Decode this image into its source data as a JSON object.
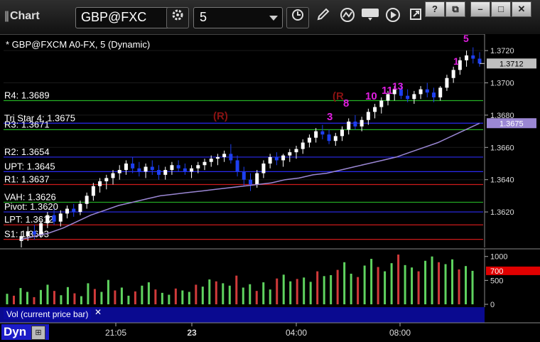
{
  "window": {
    "title": "Chart",
    "symbol": "GBP@FXC",
    "timeframe": "5"
  },
  "colors": {
    "bg": "#000000",
    "level_green": "#25b125",
    "level_red": "#cc1a1a",
    "level_blue": "#2a2af0",
    "up_candle": "#ffffff",
    "down_candle": "#1e3ff0",
    "ma": "#9b87d4",
    "vol_bar_green": "#5fd35f",
    "vol_bar_red": "#d13a3a",
    "annot_magenta": "#e01ee0",
    "annot_dark_red": "#8a1212",
    "annot_green": "#2fbf2f"
  },
  "header_label": "* GBP@FXCM A0-FX, 5 (Dynamic)",
  "levels": [
    {
      "label": "R4: 1.3689",
      "price": 1.3689,
      "color": "green"
    },
    {
      "label": "Tri Star 4: 1.3675",
      "price": 1.3675,
      "color": "blue"
    },
    {
      "label": "R3: 1.3671",
      "price": 1.3671,
      "color": "green"
    },
    {
      "label": "R2: 1.3654",
      "price": 1.3654,
      "color": "blue"
    },
    {
      "label": "UPT: 1.3645",
      "price": 1.3645,
      "color": "blue"
    },
    {
      "label": "R1: 1.3637",
      "price": 1.3637,
      "color": "red"
    },
    {
      "label": "VAH: 1.3626",
      "price": 1.3626,
      "color": "green"
    },
    {
      "label": "Pivot: 1.3620",
      "price": 1.362,
      "color": "blue"
    },
    {
      "label": "LPT: 1.3612",
      "price": 1.3612,
      "color": "red"
    },
    {
      "label": "S1: 1.3603",
      "price": 1.3603,
      "color": "red"
    }
  ],
  "annotations": [
    "(R)",
    "(R",
    "3",
    "8",
    "10",
    "11",
    "13",
    "5",
    "1"
  ],
  "chart_data": {
    "type": "candlestick",
    "price_axis": {
      "ticks": [
        1.372,
        1.37,
        1.368,
        1.366,
        1.364,
        1.362
      ],
      "tick_labels": [
        "1.3720",
        "1.3700",
        "1.3680",
        "1.3660",
        "1.3640",
        "1.3620"
      ],
      "current_price": "1.3712",
      "ma_value": "1.3675"
    },
    "time_axis": {
      "tick_labels": [
        "21:05",
        "23",
        "04:00",
        "08:00"
      ]
    },
    "ohlc": [
      [
        1.3602,
        1.3608,
        1.3598,
        1.3605
      ],
      [
        1.3605,
        1.3611,
        1.3602,
        1.3608
      ],
      [
        1.3608,
        1.3612,
        1.3603,
        1.3606
      ],
      [
        1.3606,
        1.3615,
        1.3604,
        1.3613
      ],
      [
        1.3613,
        1.362,
        1.361,
        1.3618
      ],
      [
        1.3618,
        1.3622,
        1.3612,
        1.3614
      ],
      [
        1.3614,
        1.3621,
        1.3611,
        1.3619
      ],
      [
        1.3619,
        1.3624,
        1.3616,
        1.3622
      ],
      [
        1.3622,
        1.3625,
        1.3617,
        1.362
      ],
      [
        1.362,
        1.3627,
        1.3618,
        1.3625
      ],
      [
        1.3625,
        1.3632,
        1.3622,
        1.363
      ],
      [
        1.363,
        1.3638,
        1.3627,
        1.3636
      ],
      [
        1.3636,
        1.3641,
        1.3632,
        1.3639
      ],
      [
        1.3639,
        1.3643,
        1.3634,
        1.3641
      ],
      [
        1.3641,
        1.3646,
        1.3637,
        1.3644
      ],
      [
        1.3644,
        1.3649,
        1.364,
        1.3646
      ],
      [
        1.3646,
        1.3652,
        1.3643,
        1.365
      ],
      [
        1.365,
        1.3654,
        1.3644,
        1.3647
      ],
      [
        1.3647,
        1.3651,
        1.3642,
        1.3645
      ],
      [
        1.3645,
        1.365,
        1.3641,
        1.3648
      ],
      [
        1.3648,
        1.3652,
        1.3643,
        1.3646
      ],
      [
        1.3646,
        1.3649,
        1.364,
        1.3643
      ],
      [
        1.3643,
        1.3648,
        1.364,
        1.3646
      ],
      [
        1.3646,
        1.3651,
        1.3643,
        1.3649
      ],
      [
        1.3649,
        1.3652,
        1.3645,
        1.3647
      ],
      [
        1.3647,
        1.365,
        1.3643,
        1.3645
      ],
      [
        1.3645,
        1.3649,
        1.3641,
        1.3647
      ],
      [
        1.3647,
        1.3651,
        1.3644,
        1.3649
      ],
      [
        1.3649,
        1.3653,
        1.3646,
        1.3651
      ],
      [
        1.3651,
        1.3655,
        1.3648,
        1.3653
      ],
      [
        1.3653,
        1.3656,
        1.3649,
        1.3654
      ],
      [
        1.3654,
        1.3658,
        1.3651,
        1.3656
      ],
      [
        1.3656,
        1.3662,
        1.365,
        1.3652
      ],
      [
        1.3652,
        1.3655,
        1.3642,
        1.3645
      ],
      [
        1.3645,
        1.3648,
        1.3636,
        1.364
      ],
      [
        1.364,
        1.3644,
        1.3633,
        1.3637
      ],
      [
        1.3637,
        1.3646,
        1.3635,
        1.3644
      ],
      [
        1.3644,
        1.3652,
        1.3641,
        1.365
      ],
      [
        1.365,
        1.3656,
        1.3647,
        1.3654
      ],
      [
        1.3654,
        1.3657,
        1.3649,
        1.3652
      ],
      [
        1.3652,
        1.3656,
        1.3648,
        1.3655
      ],
      [
        1.3655,
        1.3659,
        1.3651,
        1.3657
      ],
      [
        1.3657,
        1.3661,
        1.3653,
        1.3659
      ],
      [
        1.3659,
        1.3665,
        1.3656,
        1.3663
      ],
      [
        1.3663,
        1.3668,
        1.366,
        1.3666
      ],
      [
        1.3666,
        1.3672,
        1.3663,
        1.367
      ],
      [
        1.367,
        1.3674,
        1.3665,
        1.3668
      ],
      [
        1.3668,
        1.3671,
        1.3662,
        1.3664
      ],
      [
        1.3664,
        1.3669,
        1.3661,
        1.3667
      ],
      [
        1.3667,
        1.3673,
        1.3664,
        1.3671
      ],
      [
        1.3671,
        1.3678,
        1.3668,
        1.3676
      ],
      [
        1.3676,
        1.368,
        1.3671,
        1.3673
      ],
      [
        1.3673,
        1.3679,
        1.367,
        1.3677
      ],
      [
        1.3677,
        1.3684,
        1.3674,
        1.3682
      ],
      [
        1.3682,
        1.3687,
        1.3678,
        1.3685
      ],
      [
        1.3685,
        1.3691,
        1.3681,
        1.3689
      ],
      [
        1.3689,
        1.3695,
        1.3686,
        1.3693
      ],
      [
        1.3693,
        1.3698,
        1.3689,
        1.3696
      ],
      [
        1.3696,
        1.3699,
        1.369,
        1.3692
      ],
      [
        1.3692,
        1.3696,
        1.3688,
        1.369
      ],
      [
        1.369,
        1.3695,
        1.3687,
        1.3693
      ],
      [
        1.3693,
        1.3698,
        1.369,
        1.3696
      ],
      [
        1.3696,
        1.37,
        1.3691,
        1.3694
      ],
      [
        1.3694,
        1.3697,
        1.3688,
        1.3691
      ],
      [
        1.3691,
        1.3698,
        1.3689,
        1.3697
      ],
      [
        1.3697,
        1.3705,
        1.3695,
        1.3703
      ],
      [
        1.3703,
        1.371,
        1.37,
        1.3708
      ],
      [
        1.3708,
        1.3716,
        1.3705,
        1.3714
      ],
      [
        1.3714,
        1.372,
        1.371,
        1.3717
      ],
      [
        1.3717,
        1.3722,
        1.3712,
        1.3715
      ],
      [
        1.3715,
        1.3719,
        1.371,
        1.3712
      ]
    ],
    "ma": [
      1.3603,
      1.3605,
      1.3607,
      1.361,
      1.3614,
      1.3618,
      1.3621,
      1.3624,
      1.3626,
      1.3628,
      1.363,
      1.3631,
      1.3632,
      1.3633,
      1.3634,
      1.3635,
      1.3636,
      1.3637,
      1.3638,
      1.364,
      1.3641,
      1.3643,
      1.3644,
      1.3646,
      1.3648,
      1.365,
      1.3652,
      1.3654,
      1.3657,
      1.366,
      1.3663,
      1.3667,
      1.3671,
      1.3675
    ],
    "volume_axis": {
      "ticks": [
        1000,
        500,
        0
      ],
      "tick_labels": [
        "1000",
        "500",
        "0"
      ],
      "current": "700",
      "max": 1100
    },
    "volume": [
      220,
      180,
      340,
      260,
      150,
      300,
      410,
      280,
      190,
      360,
      230,
      170,
      440,
      320,
      260,
      510,
      290,
      350,
      180,
      270,
      390,
      460,
      310,
      240,
      200,
      330,
      290,
      260,
      410,
      370,
      520,
      480,
      440,
      390,
      600,
      350,
      420,
      280,
      460,
      310,
      540,
      620,
      480,
      530,
      560,
      470,
      690,
      590,
      610,
      720,
      880,
      640,
      570,
      810,
      950,
      780,
      690,
      860,
      1040,
      820,
      770,
      690,
      910,
      1000,
      880,
      840,
      940,
      730,
      800,
      700
    ],
    "volume_label": "Vol (current price bar)"
  },
  "footer": {
    "label": "Dyn"
  }
}
